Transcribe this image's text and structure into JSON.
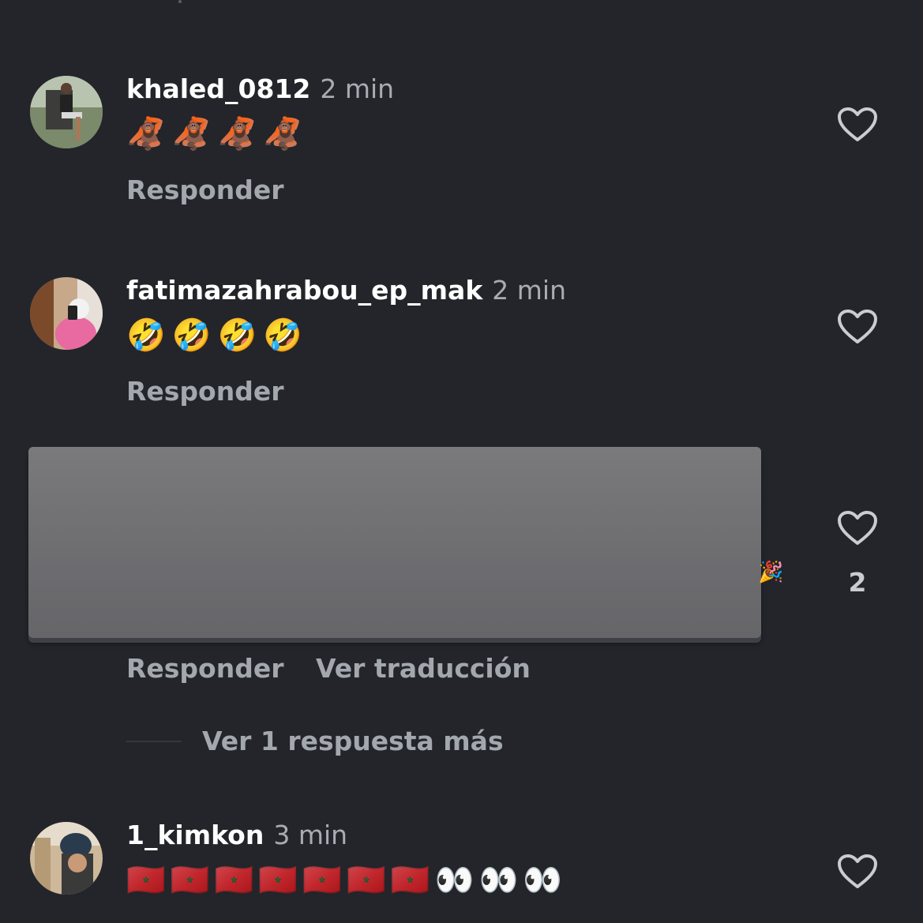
{
  "comments": [
    {
      "username": "khaled_0812",
      "time": "2 min",
      "text": "🦧🦧🦧🦧",
      "reply_label": "Responder",
      "avatar": "photo-man-sitting-chair"
    },
    {
      "username": "fatimazahrabou_ep_mak",
      "time": "2 min",
      "text": "🤣🤣🤣🤣",
      "reply_label": "Responder",
      "avatar": "photo-woman-mirror-selfie"
    },
    {
      "redacted": true,
      "trailing_emoji": "🎉",
      "like_count": "2",
      "reply_label": "Responder",
      "translate_label": "Ver traducción",
      "more_replies_label": "Ver 1 respuesta más"
    },
    {
      "username": "1_kimkon",
      "time": "3 min",
      "text": "🇲🇦🇲🇦🇲🇦🇲🇦🇲🇦🇲🇦🇲🇦👀👀👀",
      "avatar": "photo-person-knit-hat"
    }
  ],
  "icons": {
    "like": "heart-outline-icon"
  },
  "colors": {
    "background": "#23252a",
    "username": "#ffffff",
    "secondary_text": "#a8acb3",
    "redaction": "#707073"
  }
}
